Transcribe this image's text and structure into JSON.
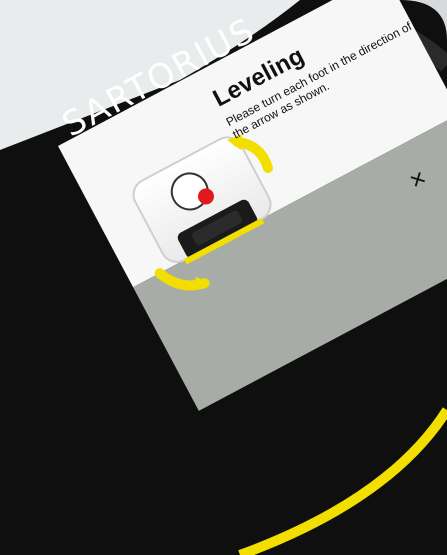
{
  "device": {
    "brand": "SARTORIUS"
  },
  "dialog": {
    "title": "Leveling",
    "instruction": "Please turn each foot in the direction of the arrow as shown."
  },
  "controls": {
    "close_label": "×"
  },
  "colors": {
    "frame": "#0f0f0f",
    "screen_top": "#f7f7f7",
    "screen_bottom": "#a8aca6",
    "accent_yellow": "#f2df00",
    "bubble_red": "#e0191c"
  }
}
